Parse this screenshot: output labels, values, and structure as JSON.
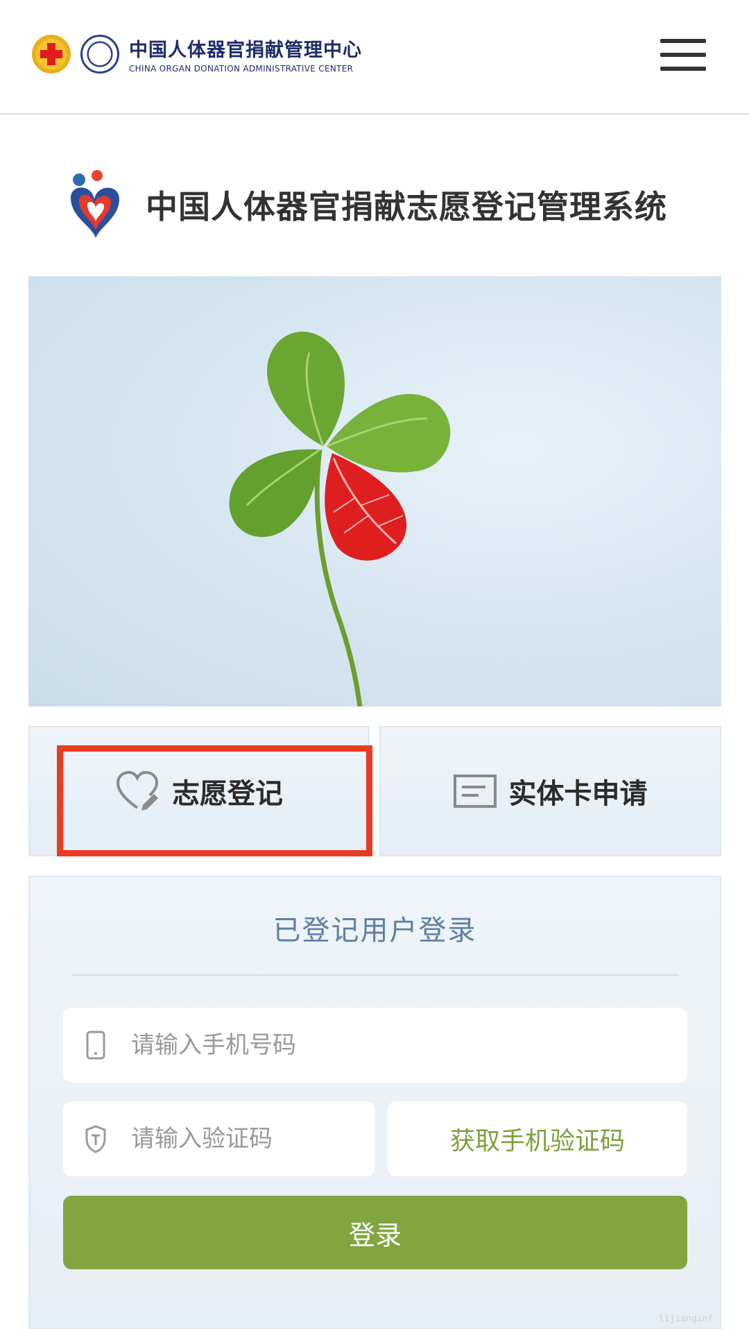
{
  "header": {
    "org_name_cn": "中国人体器官捐献管理中心",
    "org_name_en": "CHINA ORGAN DONATION ADMINISTRATIVE CENTER"
  },
  "system": {
    "title": "中国人体器官捐献志愿登记管理系统"
  },
  "banner": {
    "image": "four-leaf-clover-with-red-leaf"
  },
  "actions": {
    "register_label": "志愿登记",
    "register_icon": "heart-pen-icon",
    "card_apply_label": "实体卡申请",
    "card_apply_icon": "card-icon",
    "highlight_color": "#e73c23"
  },
  "login": {
    "title": "已登记用户登录",
    "phone_placeholder": "请输入手机号码",
    "code_placeholder": "请输入验证码",
    "get_code_label": "获取手机验证码",
    "submit_label": "登录",
    "accent_color": "#81a640"
  },
  "watermark": "lijianginf"
}
